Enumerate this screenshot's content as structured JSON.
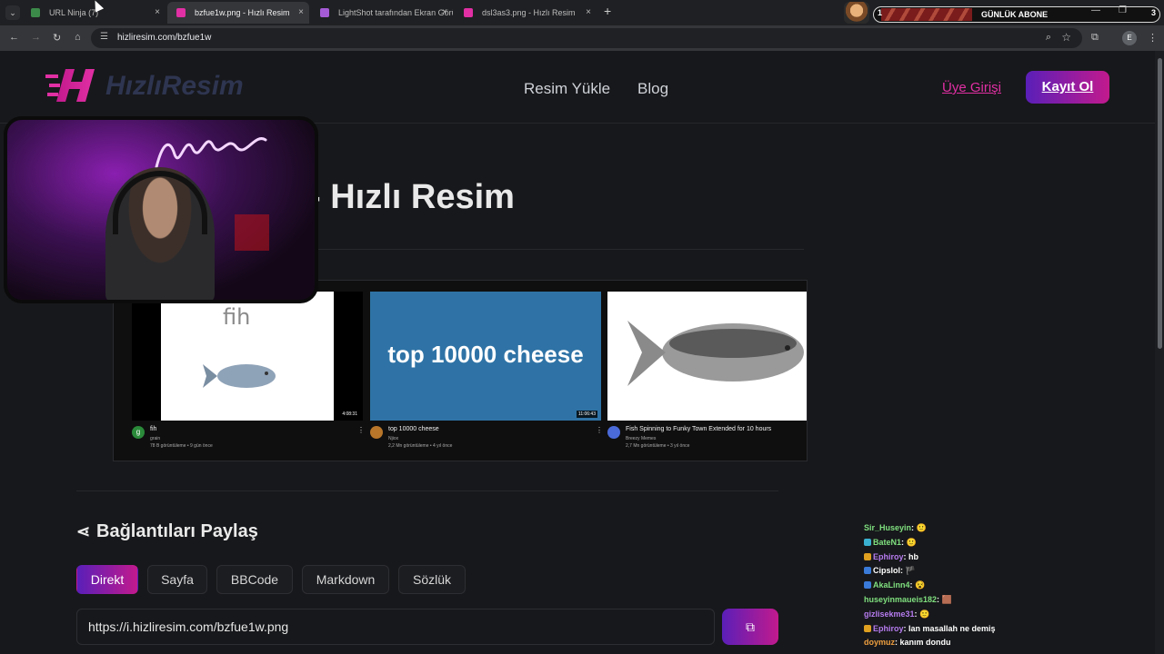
{
  "browser": {
    "tabs": [
      {
        "title": "URL Ninja (7)",
        "color": "#3c8a4a"
      },
      {
        "title": "bzfue1w.png - Hızlı Resim",
        "color": "#e12fa4"
      },
      {
        "title": "LightShot tarafından Ekran Görü",
        "color": "#a65bd6"
      },
      {
        "title": "dsl3as3.png - Hızlı Resim",
        "color": "#e12fa4"
      }
    ],
    "close_glyph": "×",
    "new_tab": "+",
    "url": "hizliresim.com/bzfue1w",
    "profile_initial": "E"
  },
  "stream_overlay": {
    "subscriber_bar_left": "1",
    "subscriber_bar_label": "GÜNLÜK ABONE",
    "subscriber_bar_right": "3"
  },
  "site": {
    "brand_name": "HızlıResim",
    "nav": [
      "Resim Yükle",
      "Blog"
    ],
    "login": "Üye Girişi",
    "register": "Kayıt Ol",
    "title_visible": "- Hızlı Resim",
    "accent_start": "#5a1fb8",
    "accent_end": "#c21a8d"
  },
  "preview": {
    "videos": [
      {
        "thumb_text": "fih",
        "duration": "4:08:31",
        "title": "fih",
        "channel": "grain",
        "stats": "78 B görüntüleme • 9 gün önce",
        "avatar_color": "#2a8a3a",
        "avatar_letter": "g"
      },
      {
        "thumb_text": "top 10000 cheese",
        "duration": "11:06:43",
        "title": "top 10000 cheese",
        "channel": "Njiox",
        "stats": "2,2 Mn görüntüleme • 4 yıl önce",
        "avatar_color": "#b8762a",
        "avatar_letter": ""
      },
      {
        "thumb_text": "",
        "duration": "",
        "title": "Fish Spinning to Funky Town Extended for 10 hours",
        "channel": "Breezy Memes",
        "stats": "2,7 Mn görüntüleme • 3 yıl önce",
        "avatar_color": "#4a6ad8",
        "avatar_letter": ""
      }
    ]
  },
  "share": {
    "title": "Bağlantıları Paylaş",
    "tabs": [
      "Direkt",
      "Sayfa",
      "BBCode",
      "Markdown",
      "Sözlük"
    ],
    "active_tab": "Direkt",
    "link": "https://i.hizliresim.com/bzfue1w.png"
  },
  "chat": [
    {
      "user": "Sir_Huseyin",
      "color": "#7fe07f",
      "msg": ""
    },
    {
      "user": "BateN1",
      "color": "#7fe07f",
      "msg": ""
    },
    {
      "user": "Ephiroy",
      "color": "#b67cf0",
      "msg": "hb"
    },
    {
      "user": "Cipslol",
      "color": "#ffffff",
      "msg": ""
    },
    {
      "user": "AkaLinn4",
      "color": "#7fe07f",
      "msg": ""
    },
    {
      "user": "huseyinmaueis182",
      "color": "#7fe07f",
      "msg": ""
    },
    {
      "user": "gizlisekme31",
      "color": "#b67cf0",
      "msg": ""
    },
    {
      "user": "Ephiroy",
      "color": "#b67cf0",
      "msg": "lan masallah ne demiş"
    },
    {
      "user": "doymuz",
      "color": "#f0a040",
      "msg": "kanım dondu"
    }
  ]
}
